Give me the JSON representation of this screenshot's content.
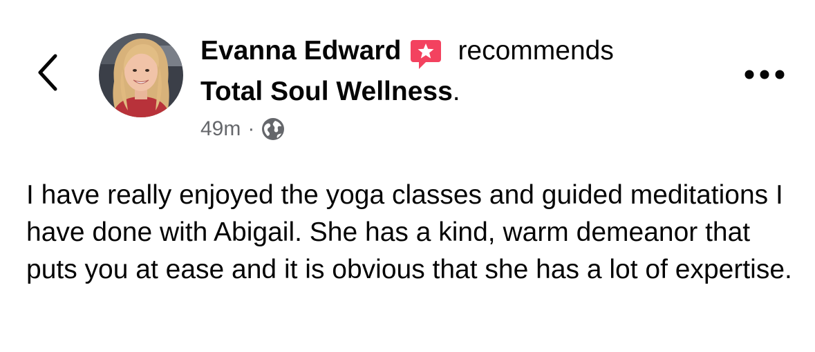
{
  "post": {
    "author_name": "Evanna Edward",
    "action_text": "recommends",
    "page_name": "Total Soul Wellness",
    "page_suffix": ".",
    "timestamp": "49m",
    "separator": "·",
    "privacy_icon": "globe-icon",
    "body": "I have really enjoyed the yoga classes and guided meditations I have done with Abigail. She has a kind, warm demeanor that puts you at ease and it is obvious that she has a lot of expertise."
  },
  "icons": {
    "back": "chevron-left-icon",
    "recommend": "recommend-star-icon",
    "more": "more-horizontal-icon"
  },
  "colors": {
    "text_primary": "#050505",
    "text_secondary": "#65676b",
    "recommend_badge": "#f3425f",
    "background": "#ffffff"
  }
}
